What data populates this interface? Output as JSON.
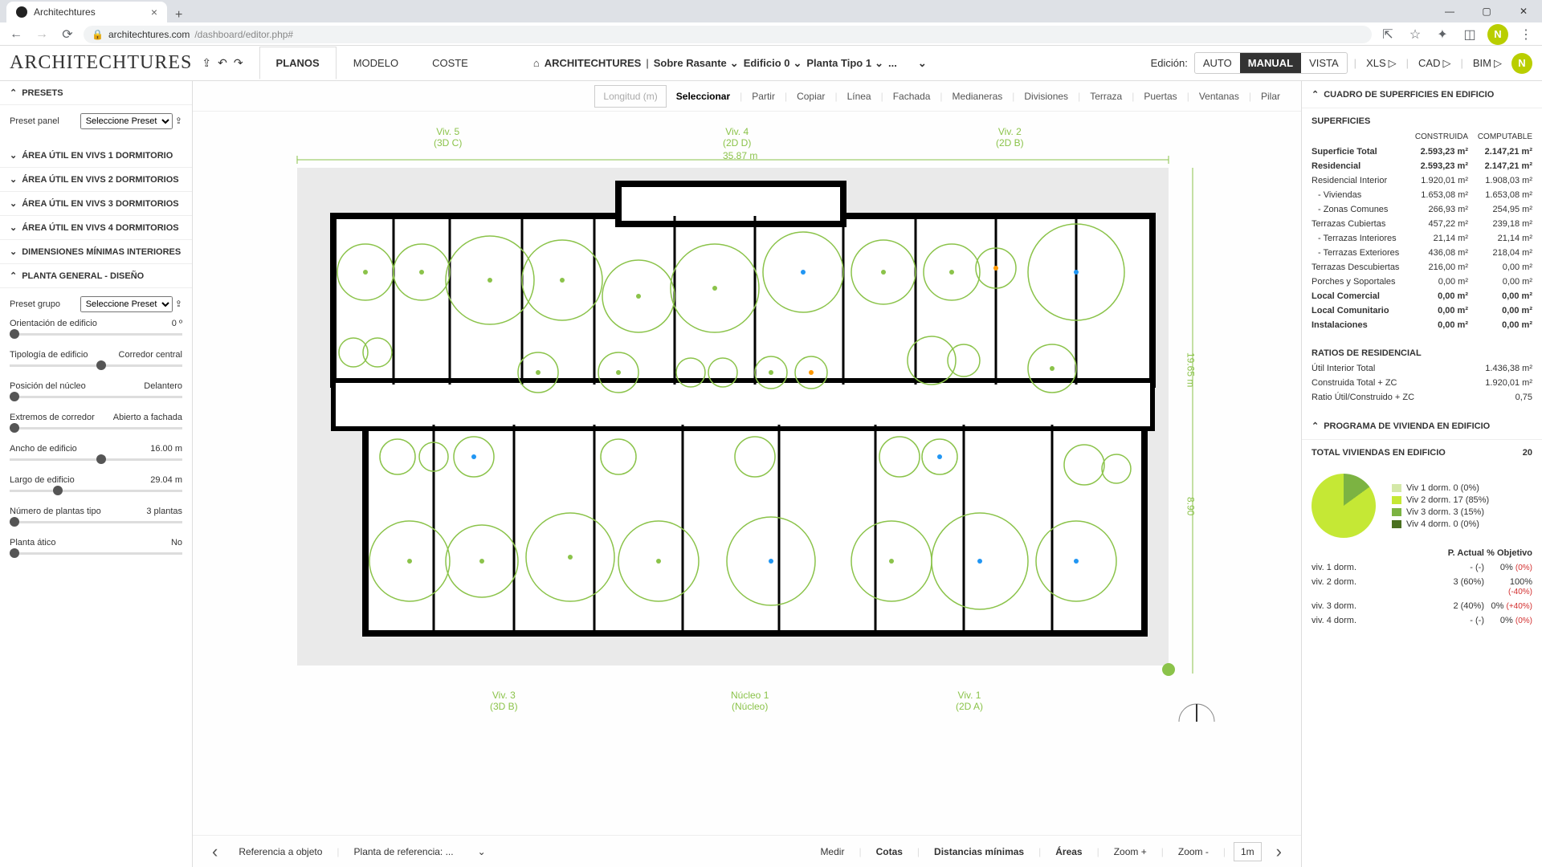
{
  "browser": {
    "tab_title": "Architechtures",
    "url_host": "architechtures.com",
    "url_path": "/dashboard/editor.php#",
    "avatar_initial": "N"
  },
  "app": {
    "logo": "ARCHITECHTURES",
    "main_tabs": [
      "PLANOS",
      "MODELO",
      "COSTE"
    ],
    "active_main_tab": 0,
    "breadcrumb": [
      "ARCHITECHTURES",
      "Sobre Rasante",
      "Edificio 0",
      "Planta Tipo 1",
      "..."
    ],
    "edit_label": "Edición:",
    "modes": [
      "AUTO",
      "MANUAL",
      "VISTA"
    ],
    "active_mode": 1,
    "exports": [
      "XLS",
      "CAD",
      "BIM"
    ],
    "avatar_initial": "N"
  },
  "left": {
    "sections": {
      "presets": "PRESETS",
      "area1": "ÁREA ÚTIL EN VIVS 1 DORMITORIO",
      "area2": "ÁREA ÚTIL EN VIVS 2 DORMITORIOS",
      "area3": "ÁREA ÚTIL EN VIVS 3 DORMITORIOS",
      "area4": "ÁREA ÚTIL EN VIVS 4 DORMITORIOS",
      "dims": "DIMENSIONES MÍNIMAS INTERIORES",
      "planta": "PLANTA GENERAL - DISEÑO"
    },
    "preset_panel_label": "Preset panel",
    "preset_select": "Seleccione Preset",
    "preset_grupo_label": "Preset grupo",
    "sliders": [
      {
        "label": "Orientación de edificio",
        "value": "0 º",
        "pos": 0
      },
      {
        "label": "Tipología de edificio",
        "value": "Corredor central",
        "pos": 50
      },
      {
        "label": "Posición del núcleo",
        "value": "Delantero",
        "pos": 0
      },
      {
        "label": "Extremos de corredor",
        "value": "Abierto a fachada",
        "pos": 0
      },
      {
        "label": "Ancho de edificio",
        "value": "16.00  m",
        "pos": 50
      },
      {
        "label": "Largo de edificio",
        "value": "29.04  m",
        "pos": 25
      },
      {
        "label": "Número de plantas tipo",
        "value": "3  plantas",
        "pos": 0
      },
      {
        "label": "Planta ático",
        "value": "No",
        "pos": 0
      }
    ]
  },
  "center_toolbar": {
    "items": [
      "Longitud (m)",
      "Seleccionar",
      "Partir",
      "Copiar",
      "Línea",
      "Fachada",
      "Medianeras",
      "Divisiones",
      "Terraza",
      "Puertas",
      "Ventanas",
      "Pilar"
    ],
    "boxed": 0,
    "active": 1
  },
  "plan_labels": {
    "viv5": {
      "line1": "Viv. 5",
      "line2": "(3D C)"
    },
    "viv4": {
      "line1": "Viv. 4",
      "line2": "(2D D)"
    },
    "viv2": {
      "line1": "Viv. 2",
      "line2": "(2D B)"
    },
    "viv3": {
      "line1": "Viv. 3",
      "line2": "(3D B)"
    },
    "nucleo": {
      "line1": "Núcleo 1",
      "line2": "(Núcleo)"
    },
    "viv1": {
      "line1": "Viv. 1",
      "line2": "(2D A)"
    },
    "width": "35.87 m",
    "height": "19.65 m",
    "height2": "8.90"
  },
  "bottom": {
    "ref_obj": "Referencia a objeto",
    "planta_ref": "Planta de referencia:  ...",
    "items": [
      "Medir",
      "Cotas",
      "Distancias mínimas",
      "Áreas",
      "Zoom +",
      "Zoom -",
      "1m"
    ]
  },
  "right": {
    "header1": "CUADRO DE SUPERFICIES EN EDIFICIO",
    "surf_title": "SUPERFICIES",
    "col_head": [
      "CONSTRUIDA",
      "COMPUTABLE"
    ],
    "rows": [
      {
        "l": "Superficie Total",
        "c": "2.593,23 m²",
        "p": "2.147,21 m²",
        "bold": true
      },
      {
        "l": "Residencial",
        "c": "2.593,23 m²",
        "p": "2.147,21 m²",
        "bold": true
      },
      {
        "l": "Residencial Interior",
        "c": "1.920,01 m²",
        "p": "1.908,03 m²"
      },
      {
        "l": "- Viviendas",
        "c": "1.653,08 m²",
        "p": "1.653,08 m²",
        "indent": true
      },
      {
        "l": "- Zonas Comunes",
        "c": "266,93 m²",
        "p": "254,95 m²",
        "indent": true
      },
      {
        "l": "Terrazas Cubiertas",
        "c": "457,22 m²",
        "p": "239,18 m²"
      },
      {
        "l": "- Terrazas Interiores",
        "c": "21,14 m²",
        "p": "21,14 m²",
        "indent": true
      },
      {
        "l": "- Terrazas Exteriores",
        "c": "436,08 m²",
        "p": "218,04 m²",
        "indent": true
      },
      {
        "l": "Terrazas Descubiertas",
        "c": "216,00 m²",
        "p": "0,00 m²"
      },
      {
        "l": "Porches y Soportales",
        "c": "0,00 m²",
        "p": "0,00 m²"
      },
      {
        "l": "Local Comercial",
        "c": "0,00 m²",
        "p": "0,00 m²",
        "bold": true
      },
      {
        "l": "Local Comunitario",
        "c": "0,00 m²",
        "p": "0,00 m²",
        "bold": true
      },
      {
        "l": "Instalaciones",
        "c": "0,00 m²",
        "p": "0,00 m²",
        "bold": true
      }
    ],
    "ratios_title": "RATIOS DE RESIDENCIAL",
    "ratios": [
      {
        "l": "Útil Interior Total",
        "v": "1.436,38 m²"
      },
      {
        "l": "Construida Total + ZC",
        "v": "1.920,01 m²"
      },
      {
        "l": "Ratio Útil/Construido + ZC",
        "v": "0,75"
      }
    ],
    "header2": "PROGRAMA DE VIVIENDA EN EDIFICIO",
    "total_viv_label": "TOTAL VIVIENDAS EN EDIFICIO",
    "total_viv": "20",
    "legend": [
      {
        "c": "#d4e8a8",
        "l": "Viv 1 dorm. 0 (0%)"
      },
      {
        "c": "#c5e835",
        "l": "Viv 2 dorm. 17 (85%)"
      },
      {
        "c": "#7cb342",
        "l": "Viv 3 dorm. 3 (15%)"
      },
      {
        "c": "#4a7020",
        "l": "Viv 4 dorm. 0 (0%)"
      }
    ],
    "prog_head": [
      "",
      "P. Actual",
      "% Objetivo"
    ],
    "prog_rows": [
      {
        "l": "viv. 1 dorm.",
        "a": "- (-)",
        "o": "0%",
        "d": "(0%)"
      },
      {
        "l": "viv. 2 dorm.",
        "a": "3 (60%)",
        "o": "100%",
        "d": "(-40%)"
      },
      {
        "l": "viv. 3 dorm.",
        "a": "2 (40%)",
        "o": "0%",
        "d": "(+40%)"
      },
      {
        "l": "viv. 4 dorm.",
        "a": "- (-)",
        "o": "0%",
        "d": "(0%)"
      }
    ]
  },
  "chart_data": {
    "type": "pie",
    "title": "TOTAL VIVIENDAS EN EDIFICIO",
    "categories": [
      "Viv 1 dorm.",
      "Viv 2 dorm.",
      "Viv 3 dorm.",
      "Viv 4 dorm."
    ],
    "values": [
      0,
      17,
      3,
      0
    ],
    "percentages": [
      0,
      85,
      15,
      0
    ],
    "colors": [
      "#d4e8a8",
      "#c5e835",
      "#7cb342",
      "#4a7020"
    ]
  }
}
